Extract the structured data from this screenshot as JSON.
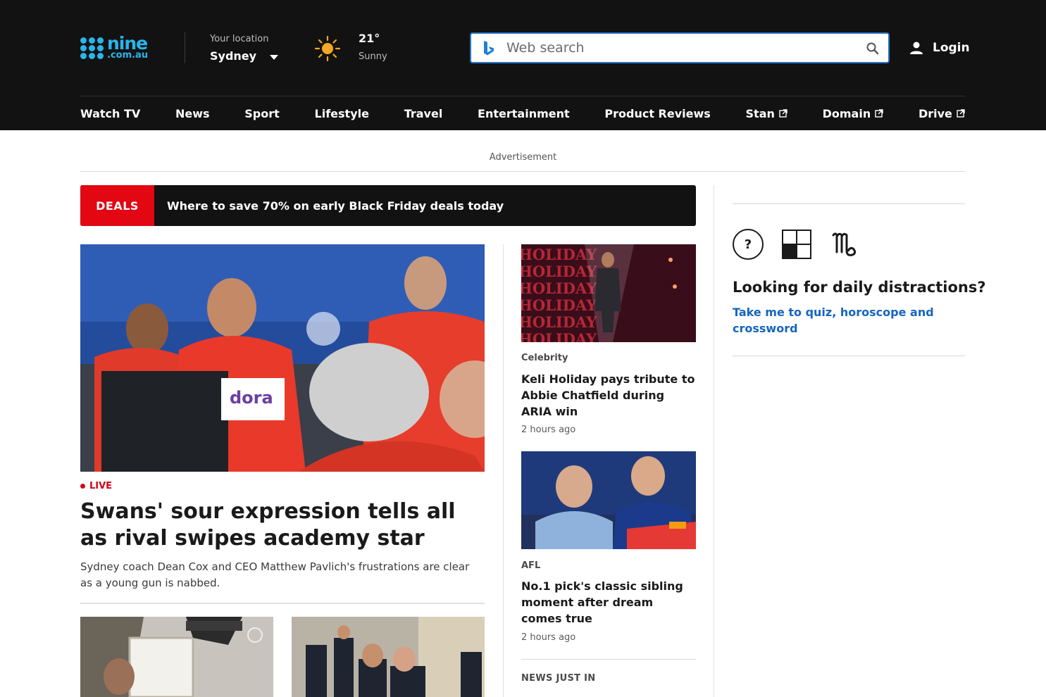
{
  "header": {
    "logo": {
      "line1": "nine",
      "line2": ".com.au"
    },
    "location": {
      "label": "Your location",
      "value": "Sydney"
    },
    "weather": {
      "temp": "21°",
      "condition": "Sunny",
      "icon": "sun-icon"
    },
    "search": {
      "placeholder": "Web search",
      "value": ""
    },
    "login_label": "Login"
  },
  "nav": {
    "items": [
      {
        "label": "Watch TV",
        "external": false
      },
      {
        "label": "News",
        "external": false
      },
      {
        "label": "Sport",
        "external": false
      },
      {
        "label": "Lifestyle",
        "external": false
      },
      {
        "label": "Travel",
        "external": false
      },
      {
        "label": "Entertainment",
        "external": false
      },
      {
        "label": "Product Reviews",
        "external": false
      },
      {
        "label": "Stan",
        "external": true
      },
      {
        "label": "Domain",
        "external": true
      },
      {
        "label": "Drive",
        "external": true
      }
    ]
  },
  "ad_label": "Advertisement",
  "deals": {
    "tag": "DEALS",
    "text": "Where to save 70% on early Black Friday deals today"
  },
  "hero": {
    "live_label": "LIVE",
    "title": "Swans' sour expression tells all as rival swipes academy star",
    "subtitle": "Sydney coach Dean Cox and CEO Matthew Pavlich's frustrations are clear as a young gun is nabbed."
  },
  "side_stories": [
    {
      "category": "Celebrity",
      "title": "Keli Holiday pays tribute to Abbie Chatfield during ARIA win",
      "time": "2 hours ago"
    },
    {
      "category": "AFL",
      "title": "No.1 pick's classic sibling moment after dream comes true",
      "time": "2 hours ago"
    }
  ],
  "news_just_in": "NEWS JUST IN",
  "distractions": {
    "title": "Looking for daily distractions?",
    "link": "Take me to quiz, horoscope and crossword",
    "quiz_symbol": "?",
    "icons": [
      "quiz-icon",
      "crossword-icon",
      "horoscope-icon"
    ]
  },
  "colors": {
    "header_bg": "#121212",
    "brand_blue": "#29b5ec",
    "deals_red": "#e30613",
    "link_blue": "#1565c0",
    "live_red": "#d0021b"
  }
}
